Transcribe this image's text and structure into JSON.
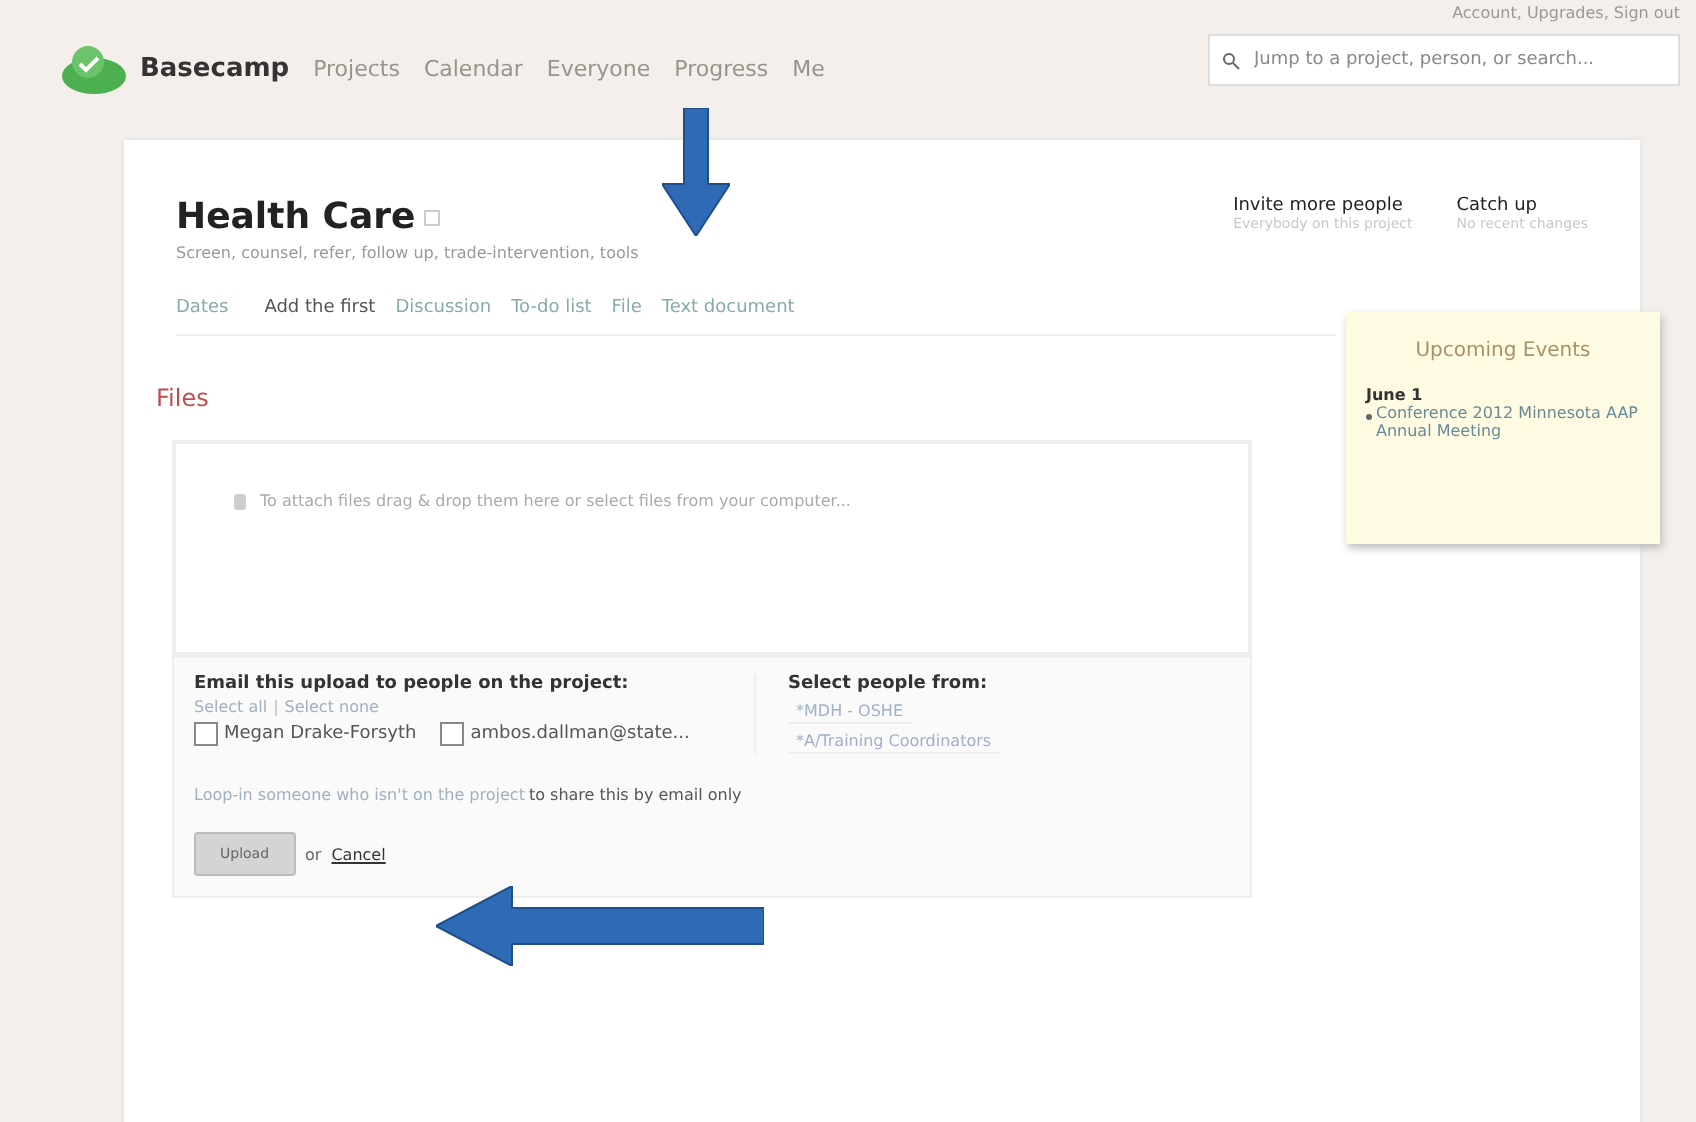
{
  "header": {
    "app_name": "Basecamp",
    "nav": [
      "Projects",
      "Calendar",
      "Everyone",
      "Progress",
      "Me"
    ],
    "account_links": "Account, Upgrades, Sign out",
    "search": {
      "placeholder": "Jump to a project, person, or search..."
    }
  },
  "project": {
    "title": "Health Care",
    "description": "Screen, counsel, refer, follow up, trade-intervention, tools",
    "actions": [
      {
        "label": "Invite more people",
        "sub": "Everybody on this project"
      },
      {
        "label": "Catch up",
        "sub": "No recent changes"
      }
    ],
    "tabs": [
      "Dates",
      "Add the first",
      "Discussion",
      "To-do list",
      "File",
      "Text document"
    ]
  },
  "files": {
    "heading": "Files",
    "drop_hint": "To attach files drag & drop them here or select files from your computer...",
    "email": {
      "heading": "Email this upload to people on the project:",
      "select_all": "Select all",
      "separator": "|",
      "select_none": "Select none",
      "people": [
        {
          "name": "Megan Drake-Forsyth",
          "checked": false
        },
        {
          "name": "ambos.dallman@state...",
          "checked": false
        }
      ],
      "groups_heading": "Select people from:",
      "groups": [
        "*MDH - OSHE",
        "*A/Training Coordinators"
      ],
      "loop_link": "Loop-in someone who isn't on the project",
      "loop_rest": "to share this by email only"
    },
    "upload": {
      "label": "Upload",
      "disabled": true
    },
    "or": "or",
    "cancel": "Cancel"
  },
  "events": {
    "title": "Upcoming Events",
    "date": "June 1",
    "items": [
      "Conference 2012 Minnesota AAP Annual Meeting"
    ]
  }
}
